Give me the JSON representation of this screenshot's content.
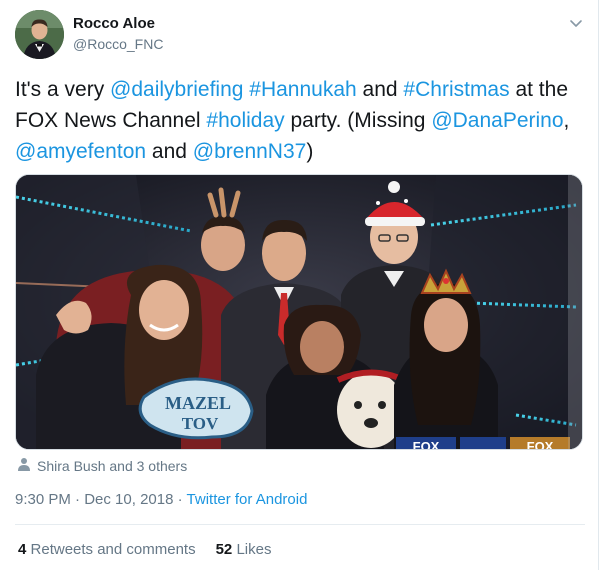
{
  "author": {
    "display_name": "Rocco Aloe",
    "handle": "@Rocco_FNC"
  },
  "tweet": {
    "segments": [
      {
        "text": "It's a very ",
        "link": false
      },
      {
        "text": "@dailybriefing",
        "link": true
      },
      {
        "text": " ",
        "link": false
      },
      {
        "text": "#Hannukah",
        "link": true
      },
      {
        "text": " and ",
        "link": false
      },
      {
        "text": "#Christmas",
        "link": true
      },
      {
        "text": " at the FOX News Channel ",
        "link": false
      },
      {
        "text": "#holiday",
        "link": true
      },
      {
        "text": " party. (Missing ",
        "link": false
      },
      {
        "text": "@DanaPerino",
        "link": true
      },
      {
        "text": ", ",
        "link": false
      },
      {
        "text": "@amyefenton",
        "link": true
      },
      {
        "text": " and ",
        "link": false
      },
      {
        "text": "@brennN37",
        "link": true
      },
      {
        "text": ")",
        "link": false
      }
    ]
  },
  "photo": {
    "sign_line1": "MAZEL",
    "sign_line2": "TOV",
    "logo_text": "FOX"
  },
  "tagged": {
    "text": "Shira Bush and 3 others",
    "icon": "person-icon"
  },
  "meta": {
    "time": "9:30 PM",
    "date": "Dec 10, 2018",
    "separator": "·",
    "source": "Twitter for Android"
  },
  "stats": {
    "retweets_count": "4",
    "retweets_label": "Retweets and comments",
    "likes_count": "52",
    "likes_label": "Likes"
  },
  "colors": {
    "link": "#1b95e0",
    "secondary": "#657786",
    "text": "#14171a"
  }
}
